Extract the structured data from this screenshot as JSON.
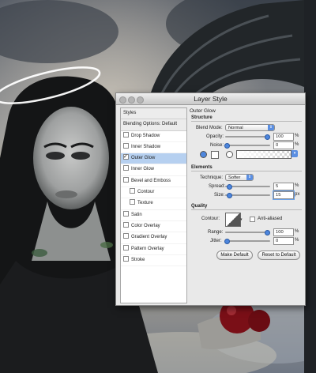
{
  "dialog": {
    "title": "Layer Style",
    "styles_list": [
      {
        "label": "Styles",
        "checkbox": false,
        "checked": false,
        "selected": false,
        "header": true,
        "indent": false
      },
      {
        "label": "Blending Options: Default",
        "checkbox": false,
        "checked": false,
        "selected": false,
        "header": true,
        "indent": false
      },
      {
        "label": "Drop Shadow",
        "checkbox": true,
        "checked": false,
        "selected": false,
        "header": false,
        "indent": false
      },
      {
        "label": "Inner Shadow",
        "checkbox": true,
        "checked": false,
        "selected": false,
        "header": false,
        "indent": false
      },
      {
        "label": "Outer Glow",
        "checkbox": true,
        "checked": true,
        "selected": true,
        "header": false,
        "indent": false
      },
      {
        "label": "Inner Glow",
        "checkbox": true,
        "checked": false,
        "selected": false,
        "header": false,
        "indent": false
      },
      {
        "label": "Bevel and Emboss",
        "checkbox": true,
        "checked": false,
        "selected": false,
        "header": false,
        "indent": false
      },
      {
        "label": "Contour",
        "checkbox": true,
        "checked": false,
        "selected": false,
        "header": false,
        "indent": true
      },
      {
        "label": "Texture",
        "checkbox": true,
        "checked": false,
        "selected": false,
        "header": false,
        "indent": true
      },
      {
        "label": "Satin",
        "checkbox": true,
        "checked": false,
        "selected": false,
        "header": false,
        "indent": false
      },
      {
        "label": "Color Overlay",
        "checkbox": true,
        "checked": false,
        "selected": false,
        "header": false,
        "indent": false
      },
      {
        "label": "Gradient Overlay",
        "checkbox": true,
        "checked": false,
        "selected": false,
        "header": false,
        "indent": false
      },
      {
        "label": "Pattern Overlay",
        "checkbox": true,
        "checked": false,
        "selected": false,
        "header": false,
        "indent": false
      },
      {
        "label": "Stroke",
        "checkbox": true,
        "checked": false,
        "selected": false,
        "header": false,
        "indent": false
      }
    ],
    "panel_title": "Outer Glow",
    "structure": {
      "title": "Structure",
      "blend_mode_label": "Blend Mode:",
      "blend_mode_value": "Normal",
      "opacity_label": "Opacity:",
      "opacity_value": "100",
      "opacity_level": 1.0,
      "opacity_unit": "%",
      "noise_label": "Noise:",
      "noise_value": "0",
      "noise_level": 0.0,
      "noise_unit": "%",
      "color_mode": "solid"
    },
    "elements": {
      "title": "Elements",
      "technique_label": "Technique:",
      "technique_value": "Softer",
      "spread_label": "Spread:",
      "spread_value": "5",
      "spread_level": 0.05,
      "spread_unit": "%",
      "size_label": "Size:",
      "size_value": "15",
      "size_level": 0.06,
      "size_unit": "px"
    },
    "quality": {
      "title": "Quality",
      "contour_label": "Contour:",
      "anti_aliased_label": "Anti-aliased",
      "anti_aliased_checked": false,
      "range_label": "Range:",
      "range_value": "100",
      "range_level": 1.0,
      "range_unit": "%",
      "jitter_label": "Jitter:",
      "jitter_value": "0",
      "jitter_level": 0.0,
      "jitter_unit": "%"
    },
    "buttons": {
      "make_default": "Make Default",
      "reset_to_default": "Reset to Default"
    }
  },
  "colors": {
    "selection": "#b6d0f0",
    "slider_knob": "#4d86dd",
    "dialog_bg": "#e9e9e9"
  }
}
